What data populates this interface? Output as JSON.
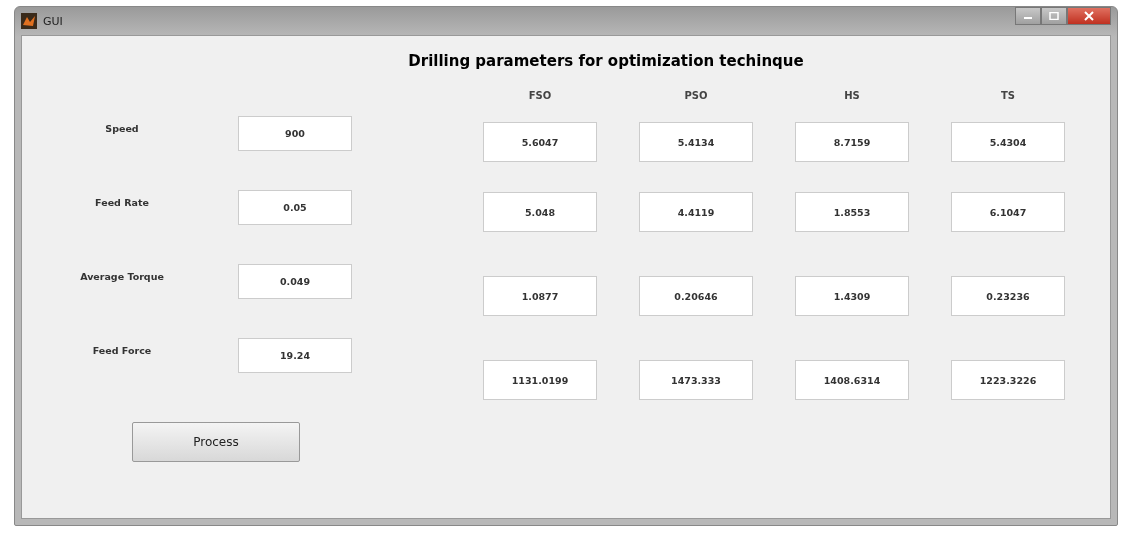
{
  "window": {
    "title": "GUI"
  },
  "heading": "Drilling parameters for optimization techinque",
  "inputs": [
    {
      "label": "Speed",
      "value": "900"
    },
    {
      "label": "Feed Rate",
      "value": "0.05"
    },
    {
      "label": "Average  Torque",
      "value": "0.049"
    },
    {
      "label": "Feed Force",
      "value": "19.24"
    }
  ],
  "methods": [
    {
      "name": "FSO",
      "values": [
        "5.6047",
        "5.048",
        "1.0877",
        "1131.0199"
      ]
    },
    {
      "name": "PSO",
      "values": [
        "5.4134",
        "4.4119",
        "0.20646",
        "1473.333"
      ]
    },
    {
      "name": "HS",
      "values": [
        "8.7159",
        "1.8553",
        "1.4309",
        "1408.6314"
      ]
    },
    {
      "name": "TS",
      "values": [
        "5.4304",
        "6.1047",
        "0.23236",
        "1223.3226"
      ]
    }
  ],
  "button": "Process"
}
